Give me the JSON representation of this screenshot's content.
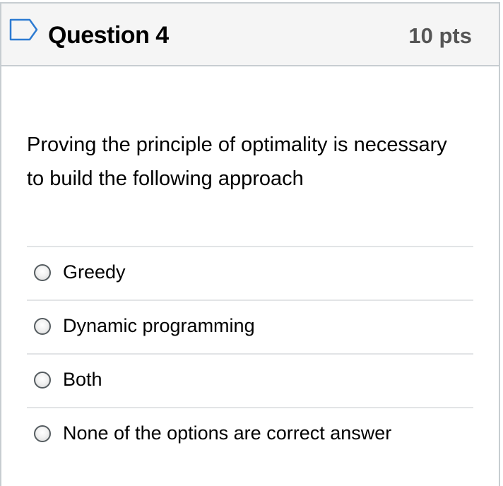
{
  "question": {
    "title": "Question 4",
    "points": "10 pts",
    "flag_icon": "flag-outline-icon",
    "text": "Proving the principle of optimality is necessary to build the following approach"
  },
  "answers": [
    {
      "label": "Greedy",
      "selected": false
    },
    {
      "label": "Dynamic programming",
      "selected": false
    },
    {
      "label": "Both",
      "selected": false
    },
    {
      "label": "None of the options are correct answer",
      "selected": false
    }
  ],
  "colors": {
    "header_bg": "#f5f5f5",
    "border": "#c7cdd1",
    "flag": "#2d7bd2",
    "points_text": "#555555"
  }
}
